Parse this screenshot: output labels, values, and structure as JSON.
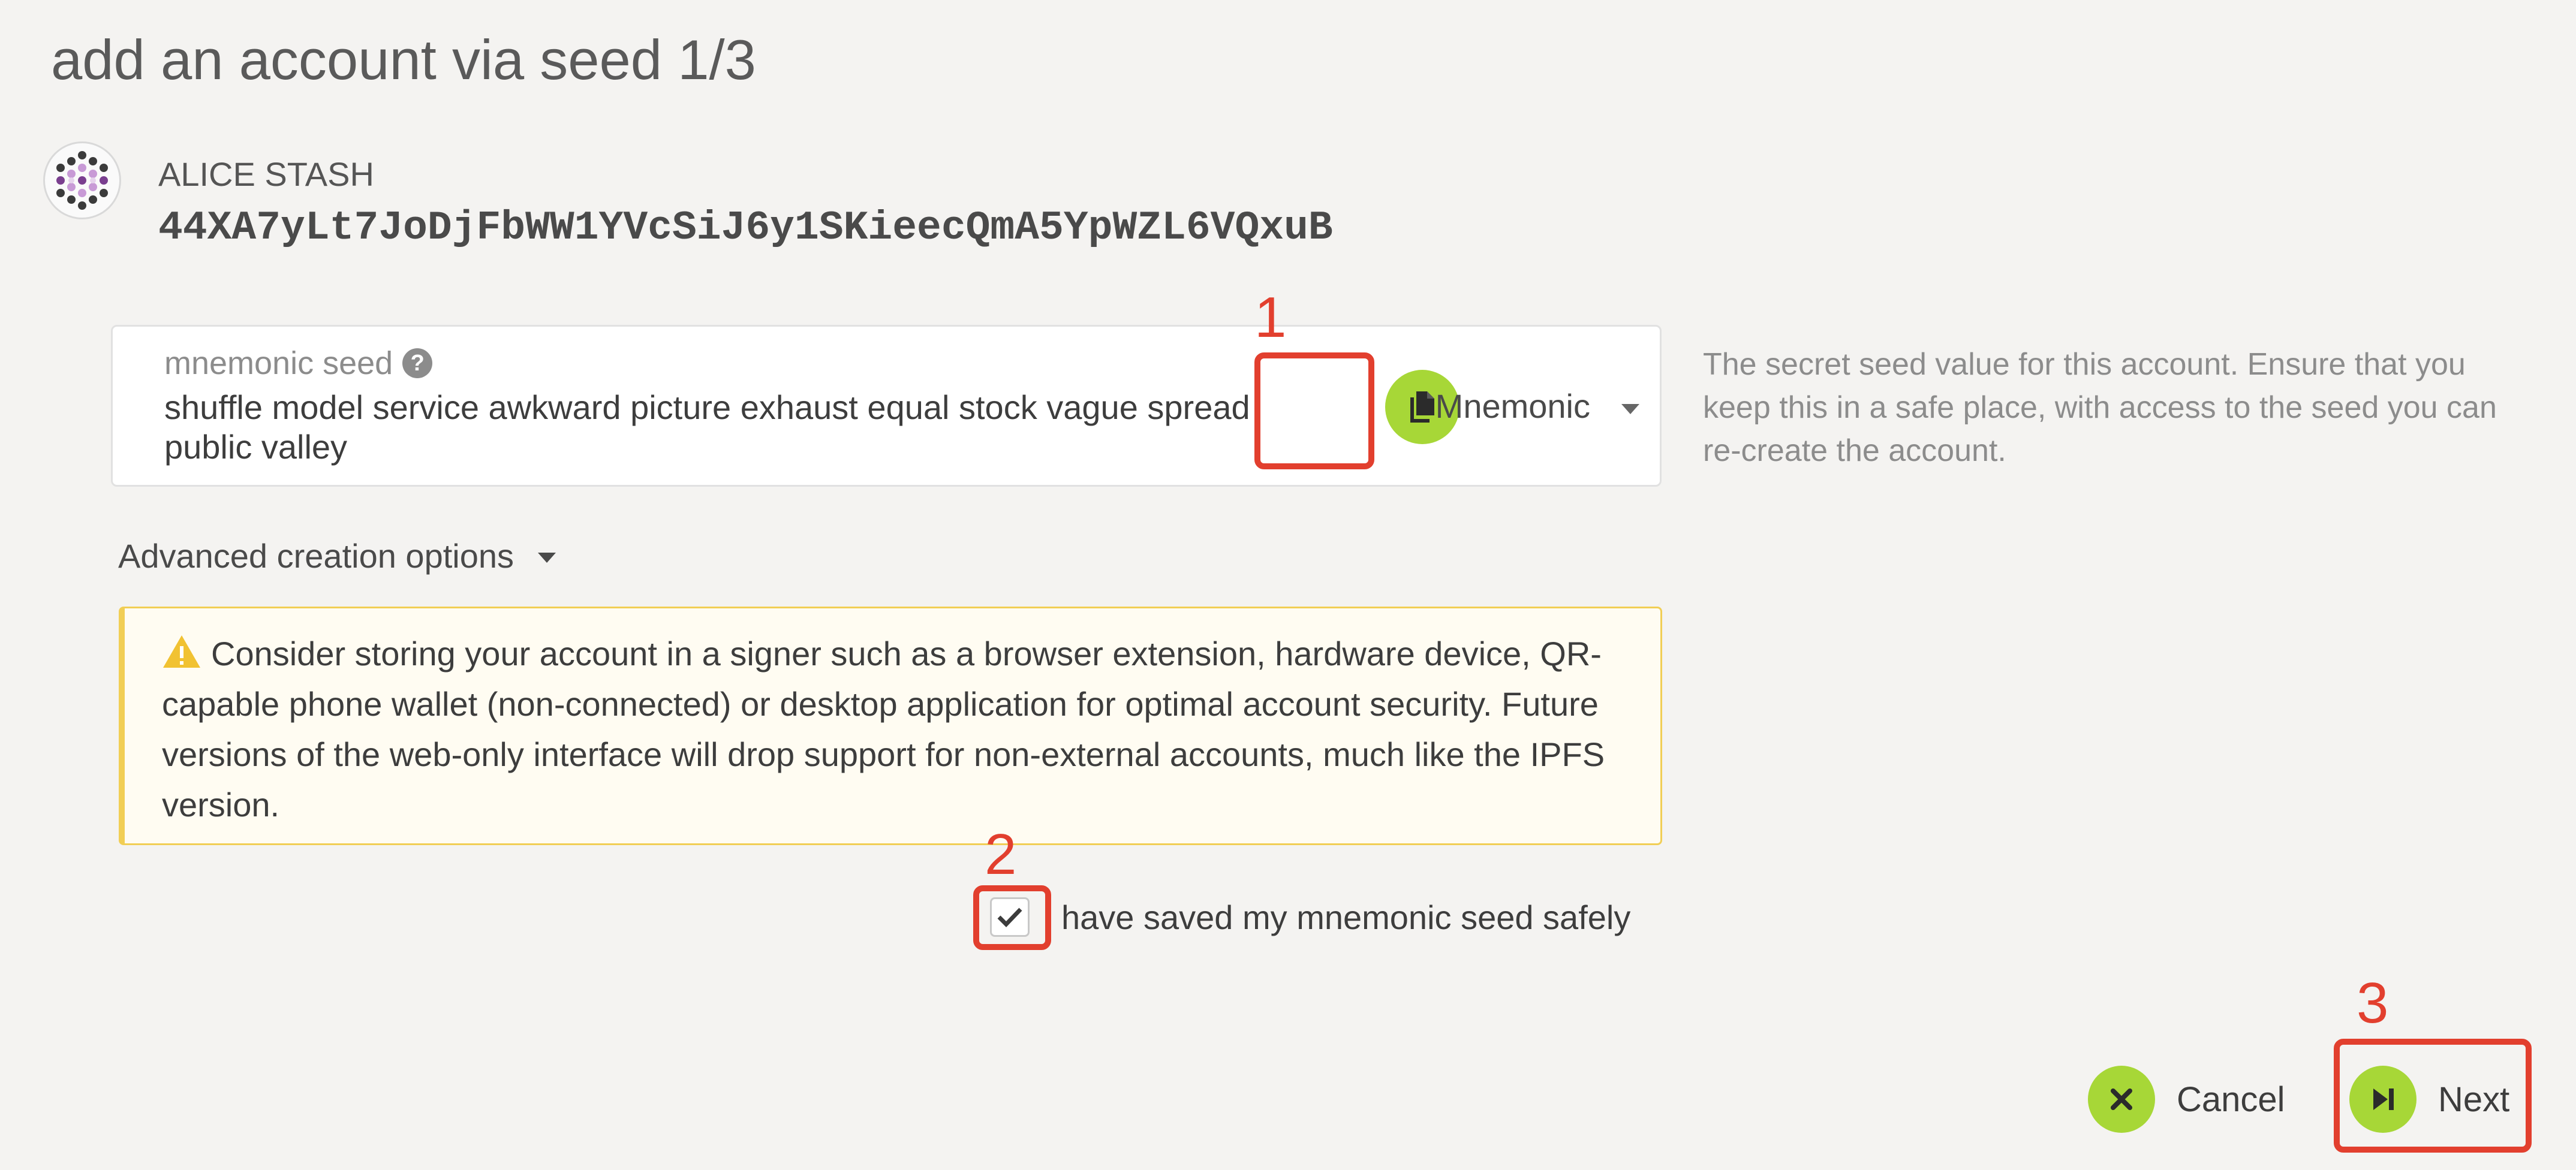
{
  "page": {
    "title": "add an account via seed 1/3"
  },
  "account": {
    "name": "ALICE STASH",
    "address": "44XA7yLt7JoDjFbWW1YVcSiJ6y1SKieecQmA5YpWZL6VQxuB",
    "identicon": "polkadot-identicon"
  },
  "seed": {
    "label": "mnemonic seed",
    "help_icon": "question-circle-icon",
    "value": "shuffle model service awkward picture exhaust equal stock vague spread public valley",
    "copy_icon": "copy-icon",
    "type_selected": "Mnemonic",
    "help_text": "The secret seed value for this account. Ensure that you keep this in a safe place, with access to the seed you can re-create the account."
  },
  "advanced": {
    "label": "Advanced creation options"
  },
  "warning": {
    "icon": "warning-icon",
    "text": "Consider storing your account in a signer such as a browser extension, hardware device, QR-capable phone wallet (non-connected) or desktop application for optimal account security. Future versions of the web-only interface will drop support for non-external accounts, much like the IPFS version."
  },
  "confirm": {
    "label": "have saved my mnemonic seed safely",
    "checked": true
  },
  "actions": {
    "cancel_label": "Cancel",
    "next_label": "Next"
  },
  "annotations": {
    "copy": "1",
    "checkbox": "2",
    "next": "3"
  },
  "colors": {
    "accent": "#a7d737",
    "annotation": "#e23f2e",
    "warning_border": "#f1ce55",
    "background": "#f4f3f1"
  }
}
